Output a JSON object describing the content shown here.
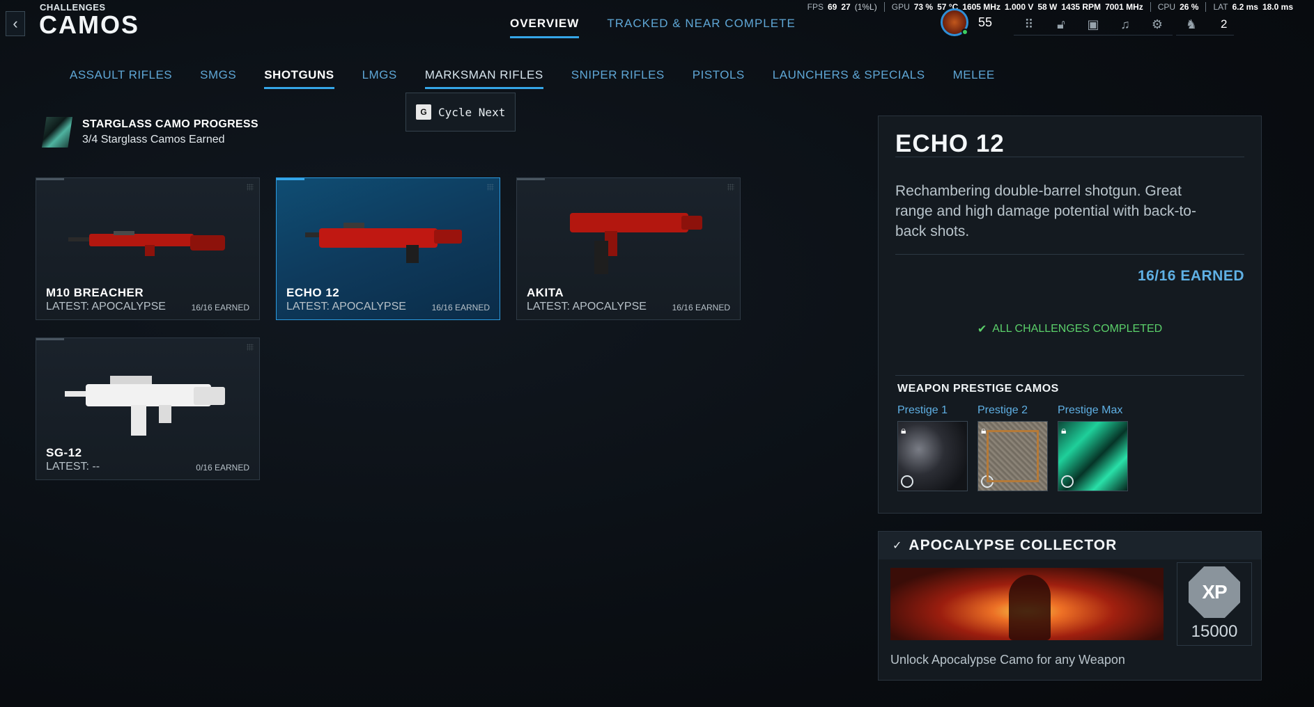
{
  "header": {
    "subtitle": "CHALLENGES",
    "title": "CAMOS",
    "tabs": [
      {
        "label": "OVERVIEW",
        "active": true
      },
      {
        "label": "TRACKED & NEAR COMPLETE",
        "active": false
      }
    ]
  },
  "perf": {
    "fps_label": "FPS",
    "fps": "69",
    "fps_low": "27",
    "fps_low_label": "(1%L)",
    "gpu_label": "GPU",
    "gpu_util": "73 %",
    "gpu_temp": "57 °C",
    "gpu_clock": "1605 MHz",
    "gpu_volt": "1.000 V",
    "gpu_power": "58 W",
    "gpu_fan": "1435 RPM",
    "gpu_mem": "7001 MHz",
    "cpu_label": "CPU",
    "cpu_util": "26 %",
    "lat_label": "LAT",
    "lat_1": "6.2 ms",
    "lat_2": "18.0 ms"
  },
  "player": {
    "level": "55",
    "party_count": "2"
  },
  "top_icons": [
    "grid-icon",
    "unlock-icon",
    "camera-icon",
    "bell-icon",
    "gear-icon",
    "friends-icon"
  ],
  "categories": [
    {
      "label": "ASSAULT RIFLES"
    },
    {
      "label": "SMGS"
    },
    {
      "label": "SHOTGUNS"
    },
    {
      "label": "LMGS"
    },
    {
      "label": "MARKSMAN RIFLES"
    },
    {
      "label": "SNIPER RIFLES"
    },
    {
      "label": "PISTOLS"
    },
    {
      "label": "LAUNCHERS & SPECIALS"
    },
    {
      "label": "MELEE"
    }
  ],
  "tooltip": {
    "key": "G",
    "label": "Cycle Next"
  },
  "starglass": {
    "title": "STARGLASS CAMO PROGRESS",
    "progress": "3/4 Starglass Camos Earned"
  },
  "weapons": [
    {
      "name": "M10 BREACHER",
      "latest": "LATEST: APOCALYPSE",
      "earned": "16/16 EARNED",
      "selected": false,
      "camo": "#b3170f"
    },
    {
      "name": "ECHO 12",
      "latest": "LATEST: APOCALYPSE",
      "earned": "16/16 EARNED",
      "selected": true,
      "camo": "#c01812"
    },
    {
      "name": "AKITA",
      "latest": "LATEST: APOCALYPSE",
      "earned": "16/16 EARNED",
      "selected": false,
      "camo": "#b3170f"
    },
    {
      "name": "SG-12",
      "latest": "LATEST: --",
      "earned": "0/16 EARNED",
      "selected": false,
      "camo": "#f2f2f2"
    }
  ],
  "detail": {
    "title": "ECHO 12",
    "description": "Rechambering double-barrel shotgun. Great range and high damage potential with back-to-back shots.",
    "earned": "16/16 EARNED",
    "complete": "ALL CHALLENGES COMPLETED",
    "prestige_title": "WEAPON PRESTIGE CAMOS",
    "prestige": [
      {
        "label": "Prestige 1"
      },
      {
        "label": "Prestige 2"
      },
      {
        "label": "Prestige Max"
      }
    ]
  },
  "collector": {
    "title": "APOCALYPSE COLLECTOR",
    "xp_label": "XP",
    "xp": "15000",
    "description": "Unlock Apocalypse Camo for any Weapon"
  }
}
